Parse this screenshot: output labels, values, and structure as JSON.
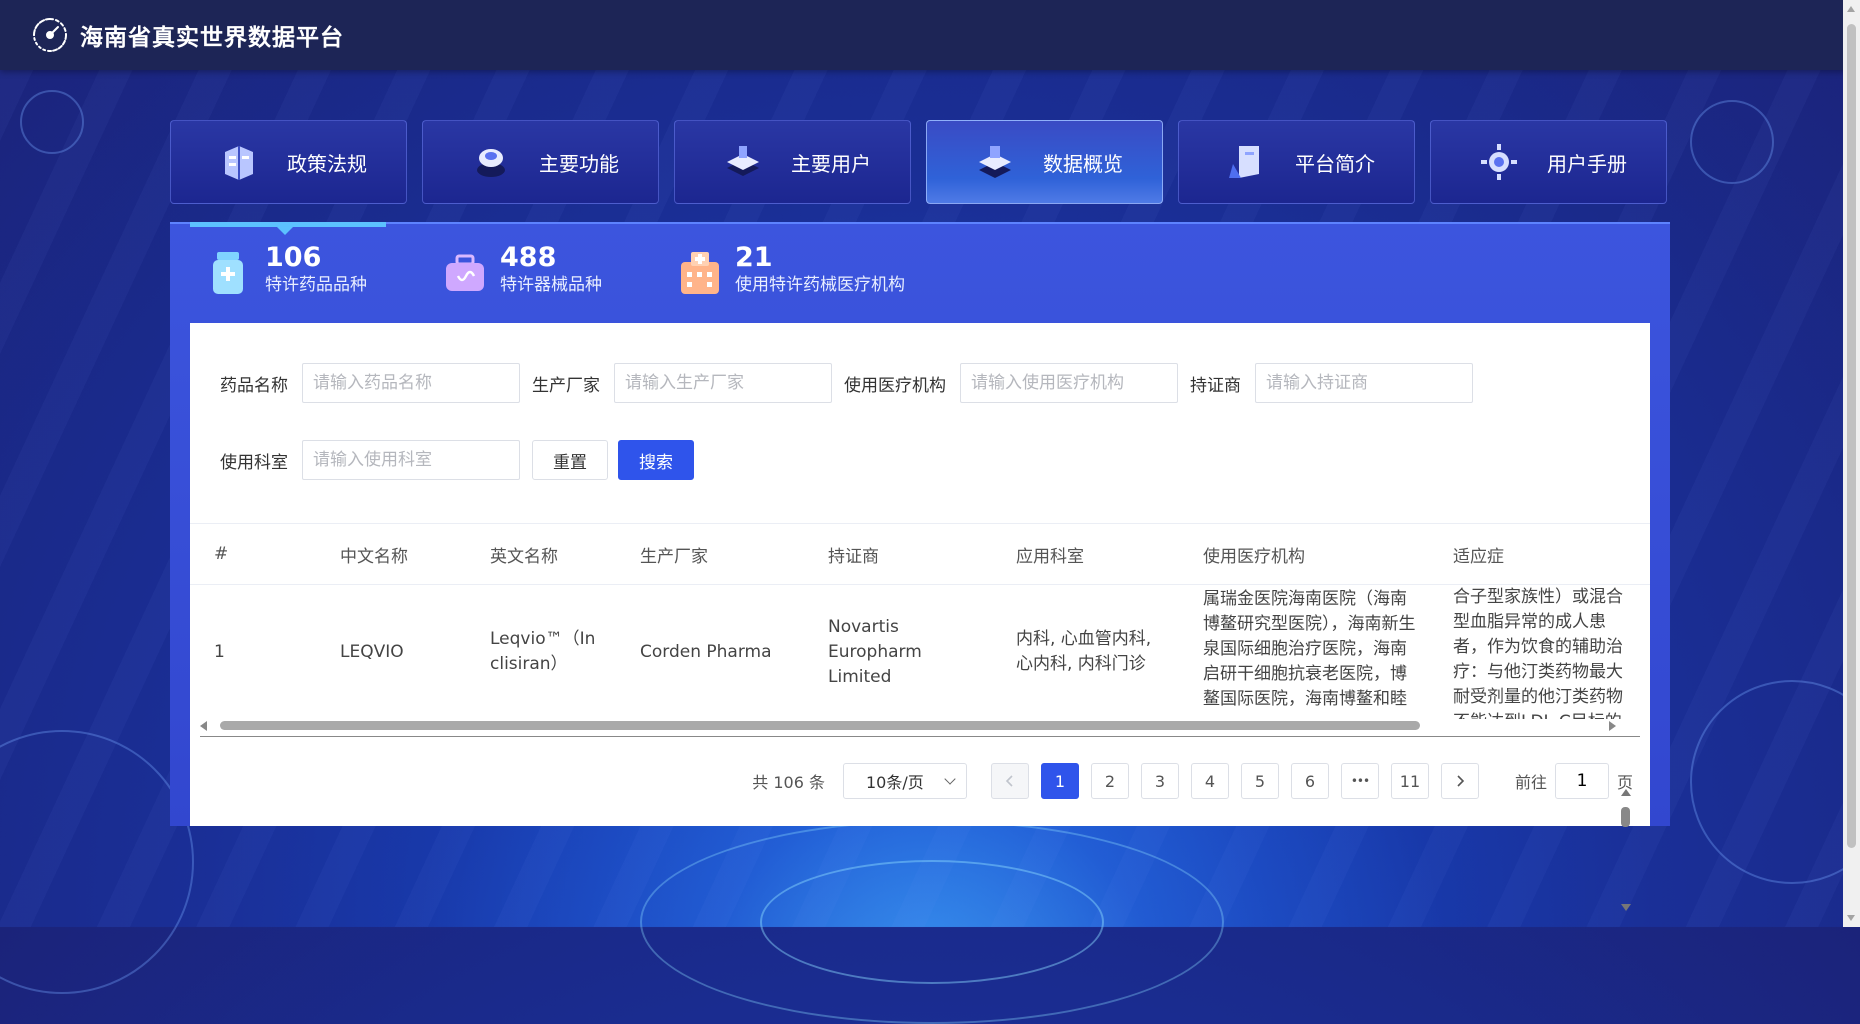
{
  "app": {
    "title": "海南省真实世界数据平台"
  },
  "nav": {
    "tabs": [
      {
        "label": "政策法规",
        "icon": "policy-book-icon"
      },
      {
        "label": "主要功能",
        "icon": "function-device-icon"
      },
      {
        "label": "主要用户",
        "icon": "users-stack-icon"
      },
      {
        "label": "数据概览",
        "icon": "data-stack-icon",
        "active": true
      },
      {
        "label": "平台简介",
        "icon": "platform-doc-icon"
      },
      {
        "label": "用户手册",
        "icon": "manual-gear-icon"
      }
    ]
  },
  "stats": [
    {
      "value": "106",
      "label": "特许药品品种",
      "icon": "medicine-bottle-icon"
    },
    {
      "value": "488",
      "label": "特许器械品种",
      "icon": "medical-kit-icon"
    },
    {
      "value": "21",
      "label": "使用特许药械医疗机构",
      "icon": "hospital-building-icon"
    }
  ],
  "filters": {
    "drug_name": {
      "label": "药品名称",
      "placeholder": "请输入药品名称",
      "value": ""
    },
    "manufacturer": {
      "label": "生产厂家",
      "placeholder": "请输入生产厂家",
      "value": ""
    },
    "institution": {
      "label": "使用医疗机构",
      "placeholder": "请输入使用医疗机构",
      "value": ""
    },
    "holder": {
      "label": "持证商",
      "placeholder": "请输入持证商",
      "value": ""
    },
    "department": {
      "label": "使用科室",
      "placeholder": "请输入使用科室",
      "value": ""
    },
    "reset_label": "重置",
    "search_label": "搜索"
  },
  "table": {
    "columns": [
      "#",
      "中文名称",
      "英文名称",
      "生产厂家",
      "持证商",
      "应用科室",
      "使用医疗机构",
      "适应症"
    ],
    "rows": [
      {
        "index": "1",
        "cn_name": "LEQVIO",
        "en_name": "Leqvio™（Inclisiran）",
        "manufacturer": "Corden Pharma",
        "holder": "Novartis Europharm Limited",
        "departments": "内科, 心血管内科, 心内科, 内科门诊",
        "institutions": "医学院第二附属医院海南医院，上海交通大学医学院附属瑞金医院海南医院（海南博鳌研究型医院），海南新生泉国际细胞治疗医院，海南启研干细胞抗衰老医院，博鳌国际医院，海南博鳌和睦",
        "indication": "合子型家族性）或混合型血脂异常的成人患者，作为饮食的辅助治疗：与他汀类药物最大耐受剂量的他汀类药物不能达到LDL-C目标的患者，联用他汀类药物；或不耐受他汀类药物或禁忌使用他汀类药物的患者，与其他降脂疗法，或单独使用；适用于降低低密度脂蛋白胆固醇"
      }
    ]
  },
  "pagination": {
    "total_text": "共 106 条",
    "page_size": "10条/页",
    "pages": [
      "1",
      "2",
      "3",
      "4",
      "5",
      "6",
      "•••",
      "11"
    ],
    "current_page": "1",
    "jump_prefix": "前往",
    "jump_value": "1",
    "jump_suffix": "页"
  }
}
